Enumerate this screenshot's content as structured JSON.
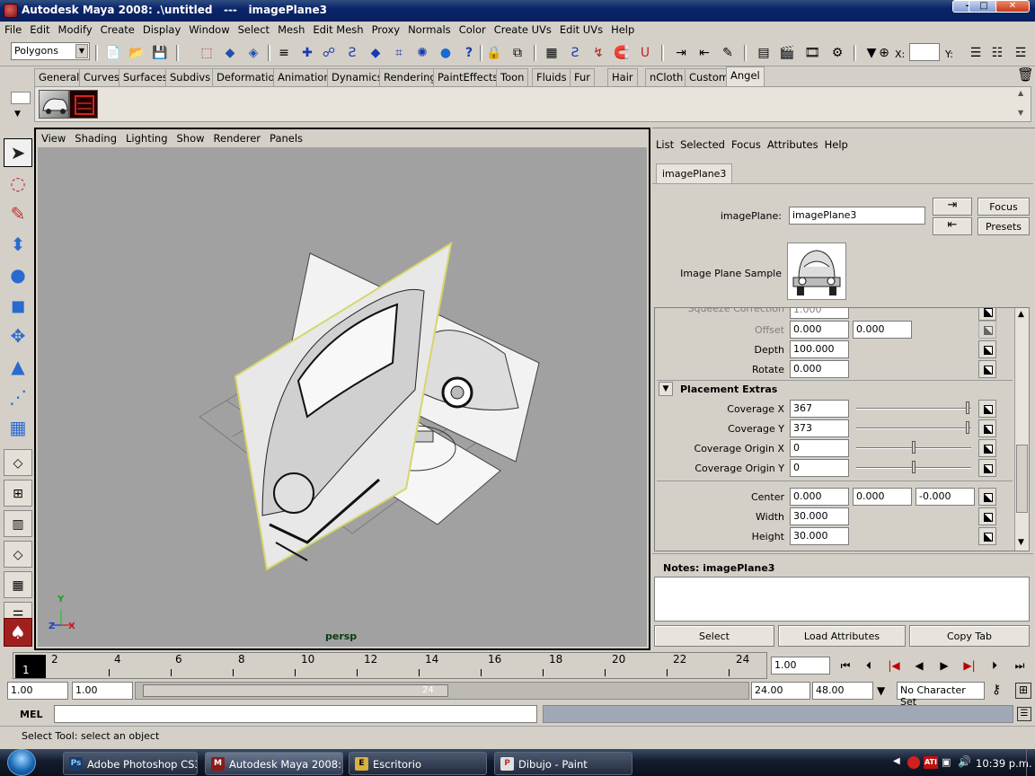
{
  "window": {
    "title": "Autodesk Maya 2008: .\\untitled   ---   imagePlane3",
    "minimize": "–",
    "maximize": "□",
    "close": "✕"
  },
  "menubar": [
    "File",
    "Edit",
    "Modify",
    "Create",
    "Display",
    "Window",
    "Select",
    "Mesh",
    "Edit Mesh",
    "Proxy",
    "Normals",
    "Color",
    "Create UVs",
    "Edit UVs",
    "Help"
  ],
  "statusline": {
    "menuset": "Polygons",
    "x_label": "X:",
    "y_label": "Y:"
  },
  "shelf_tabs": [
    "General",
    "Curves",
    "Surfaces",
    "Subdivs",
    "Deformation",
    "Animation",
    "Dynamics",
    "Rendering",
    "PaintEffects",
    "Toon",
    "Fluids",
    "Fur",
    "Hair",
    "nCloth",
    "Custom",
    "Angel"
  ],
  "shelf_active": "Angel",
  "viewport": {
    "menus": [
      "View",
      "Shading",
      "Lighting",
      "Show",
      "Renderer",
      "Panels"
    ],
    "camera_label": "persp",
    "axis_y": "Y",
    "axis_z": "Z",
    "axis_x": "X"
  },
  "attribute_editor": {
    "menus": [
      "List",
      "Selected",
      "Focus",
      "Attributes",
      "Help"
    ],
    "tab": "imagePlane3",
    "node_label": "imagePlane:",
    "node_value": "imagePlane3",
    "focus_btn": "Focus",
    "presets_btn": "Presets",
    "sample_label": "Image Plane Sample",
    "squeeze_label": "Squeeze Correction",
    "squeeze_value": "1.000",
    "offset_label": "Offset",
    "offset_x": "0.000",
    "offset_y": "0.000",
    "depth_label": "Depth",
    "depth_value": "100.000",
    "rotate_label": "Rotate",
    "rotate_value": "0.000",
    "placement_extras": "Placement Extras",
    "coverage_x_label": "Coverage X",
    "coverage_x": "367",
    "coverage_y_label": "Coverage Y",
    "coverage_y": "373",
    "cov_origin_x_label": "Coverage Origin X",
    "cov_origin_x": "0",
    "cov_origin_y_label": "Coverage Origin Y",
    "cov_origin_y": "0",
    "center_label": "Center",
    "center_x": "0.000",
    "center_y": "0.000",
    "center_z": "-0.000",
    "width_label": "Width",
    "width_value": "30.000",
    "height_label": "Height",
    "height_value": "30.000",
    "notes_label": "Notes:  imagePlane3",
    "select_btn": "Select",
    "load_btn": "Load Attributes",
    "copy_btn": "Copy Tab"
  },
  "timeline": {
    "current_frame": "1",
    "ticks": [
      "2",
      "4",
      "6",
      "8",
      "10",
      "12",
      "14",
      "16",
      "18",
      "20",
      "22",
      "24"
    ],
    "frame_field": "1.00"
  },
  "range": {
    "start": "1.00",
    "playback_start": "1.00",
    "slider_end": "24",
    "playback_end": "24.00",
    "end": "48.00",
    "character_set": "No Character Set"
  },
  "command_line": {
    "label": "MEL"
  },
  "help_line": "Select Tool: select an object",
  "taskbar": {
    "tasks": [
      {
        "label": "Adobe Photoshop CS3...",
        "icon": "Ps"
      },
      {
        "label": "Autodesk Maya 2008: ...",
        "icon": "M"
      },
      {
        "label": "Escritorio",
        "icon": "E"
      },
      {
        "label": "Dibujo - Paint",
        "icon": "P"
      }
    ],
    "clock": "10:39 p.m."
  }
}
